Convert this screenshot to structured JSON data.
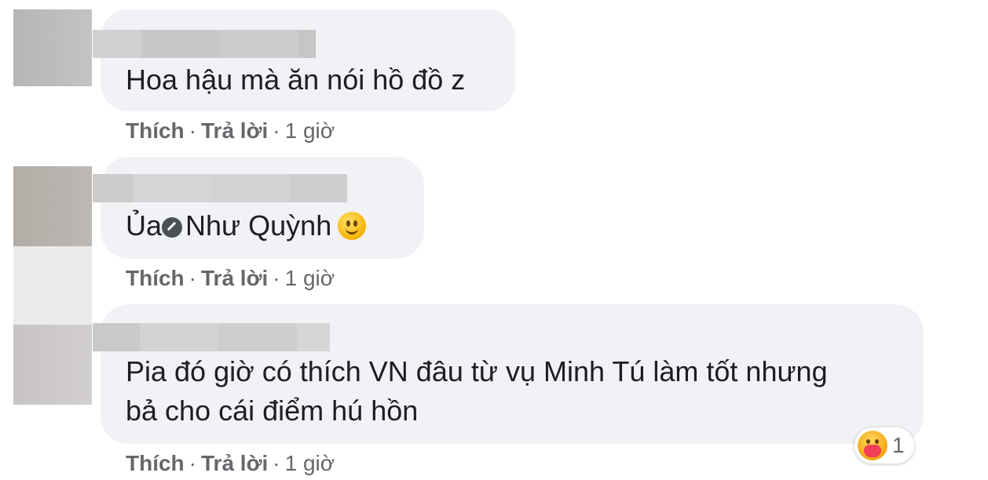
{
  "comments": [
    {
      "text": "Hoa hậu mà ăn nói hồ đồ z",
      "like_label": "Thích",
      "reply_label": "Trả lời",
      "separator": "·",
      "time": "1 giờ"
    },
    {
      "text_before": "Ủa",
      "mention": "Như Quỳnh",
      "emoji_icon": "slightly-smiling-face-icon",
      "like_label": "Thích",
      "reply_label": "Trả lời",
      "separator": "·",
      "time": "1 giờ"
    },
    {
      "text_line1": "Pia đó giờ có thích VN đâu từ vụ Minh Tú làm tốt nhưng",
      "text_line2": "bả cho cái điểm hú hồn",
      "like_label": "Thích",
      "reply_label": "Trả lời",
      "separator": "·",
      "time": "1 giờ",
      "reaction": {
        "icon": "care-reaction-icon",
        "count": "1"
      }
    }
  ],
  "colors": {
    "bubble": "#f0f2f5",
    "meta_text": "#65676b",
    "body_text": "#1c1e21"
  }
}
